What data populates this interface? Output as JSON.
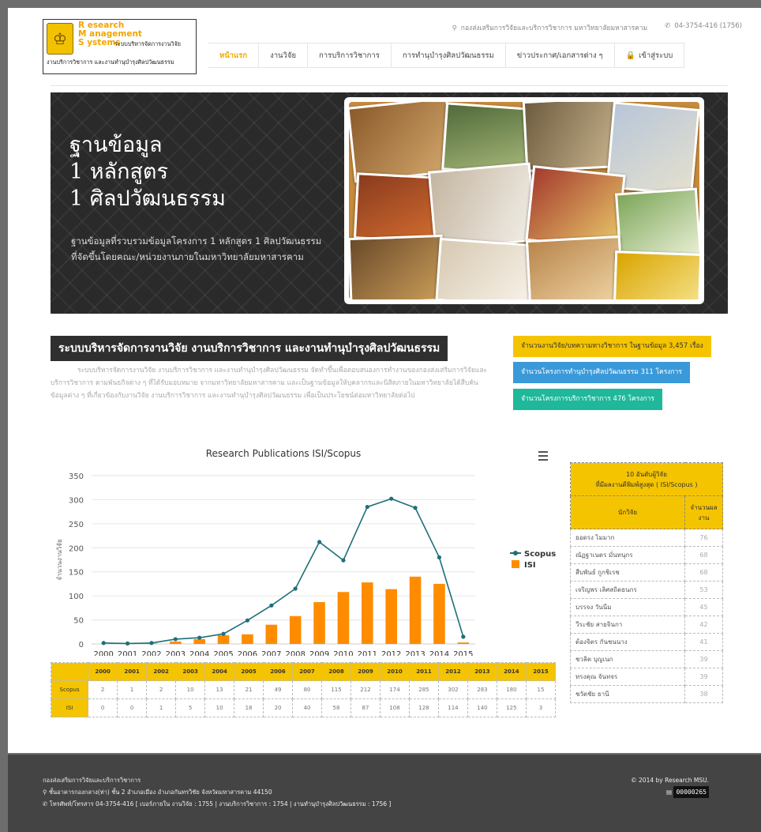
{
  "header": {
    "logo": {
      "letters": [
        "R esearch",
        "M anagement",
        "S ystems"
      ],
      "tagline": "ระบบบริหารจัดการงานวิจัย",
      "subtitle": "งานบริการวิชาการ และงานทำนุบำรุงศิลปวัฒนธรรม"
    },
    "address": "กองส่งเสริมการวิจัยและบริการวิชาการ มหาวิทยาลัยมหาสารคาม",
    "phone": "04-3754-416 (1756)",
    "nav": [
      "หน้าแรก",
      "งานวิจัย",
      "การบริการวิชาการ",
      "การทำนุบำรุงศิลปวัฒนธรรม",
      "ข่าวประกาศ/เอกสารต่าง ๆ",
      "เข้าสู่ระบบ"
    ]
  },
  "banner": {
    "headline": [
      "ฐานข้อมูล",
      "1 หลักสูตร",
      "1 ศิลปวัฒนธรรม"
    ],
    "text": "ฐานข้อมูลที่รวบรวมข้อมูลโครงการ 1 หลักสูตร 1 ศิลปวัฒนธรรม ที่จัดขึ้นโดยคณะ/หน่วยงานภายในมหาวิทยาลัยมหาสารคาม"
  },
  "section": {
    "title": "ระบบบริหารจัดการงานวิจัย งานบริการวิชาการ และงานทำนุบำรุงศิลปวัฒนธรรม",
    "description": "ระบบบริหารจัดการงานวิจัย งานบริการวิชาการ และงานทำนุบำรุงศิลปวัฒนธรรม จัดทำขึ้นเพื่อตอบสนองการทำงานของกองส่งเสริมการวิจัยและบริการวิชาการ ตามพันธกิจต่าง ๆ ที่ได้รับมอบหมาย จากมหาวิทยาลัยมหาสารคาม และเป็นฐานข้อมูลให้บุคลากรและนิสิตภายในมหาวิทยาลัยได้สืบค้นข้อมูลต่าง ๆ ที่เกี่ยวข้องกับงานวิจัย งานบริการวิชาการ และงานทำนุบำรุงศิลปวัฒนธรรม เพื่อเป็นประโยชน์ต่อมหาวิทยาลัยต่อไป"
  },
  "stats": [
    {
      "label": "จำนวนงานวิจัย/บทความทางวิชาการ ในฐานข้อมูล 3,457 เรื่อง",
      "color": "#f5c400"
    },
    {
      "label": "จำนวนโครงการทำนุบำรุงศิลปวัฒนธรรม 311 โครงการ",
      "color": "#3a9ad9"
    },
    {
      "label": "จำนวนโครงการบริการวิชาการ 476 โครงการ",
      "color": "#1fb89a"
    }
  ],
  "chart_data": {
    "type": "bar",
    "title": "Research Publications ISI/Scopus",
    "ylabel": "จำนวนงานวิจัย",
    "xlabel": "",
    "ylim": [
      0,
      350
    ],
    "yticks": [
      0,
      50,
      100,
      150,
      200,
      250,
      300,
      350
    ],
    "categories": [
      "2000",
      "2001",
      "2002",
      "2003",
      "2004",
      "2005",
      "2006",
      "2007",
      "2008",
      "2009",
      "2010",
      "2011",
      "2012",
      "2013",
      "2014",
      "2015"
    ],
    "series": [
      {
        "name": "Scopus",
        "type": "line",
        "color": "#1f6f78",
        "values": [
          2,
          1,
          2,
          10,
          13,
          21,
          49,
          80,
          115,
          212,
          174,
          285,
          302,
          283,
          180,
          15
        ]
      },
      {
        "name": "ISI",
        "type": "bar",
        "color": "#ff8c00",
        "values": [
          0,
          0,
          1,
          5,
          10,
          18,
          20,
          40,
          58,
          87,
          108,
          128,
          114,
          140,
          125,
          3
        ]
      }
    ],
    "legend": "right",
    "menu_icon": "hamburger-icon",
    "grid": true
  },
  "table_rows": [
    {
      "label": "Scopus",
      "values": [
        "2",
        "1",
        "2",
        "10",
        "13",
        "21",
        "49",
        "80",
        "115",
        "212",
        "174",
        "285",
        "302",
        "283",
        "180",
        "15"
      ]
    },
    {
      "label": "ISI",
      "values": [
        "0",
        "0",
        "1",
        "5",
        "10",
        "18",
        "20",
        "40",
        "58",
        "87",
        "108",
        "128",
        "114",
        "140",
        "125",
        "3"
      ]
    }
  ],
  "top10": {
    "caption": [
      "10 อันดับผู้วิจัย",
      "ที่มีผลงานตีพิมพ์สูงสุด ( ISI/Scopus )"
    ],
    "col_name": "นักวิจัย",
    "col_count": "จำนวนผลงาน",
    "rows": [
      {
        "name": "ยอดรง ไมมาก",
        "count": "76"
      },
      {
        "name": "ณัฏฐาเนตร มั่นทนุกร",
        "count": "68"
      },
      {
        "name": "สืบพันธ์ กูกชิเรช",
        "count": "68"
      },
      {
        "name": "เจริญพร เลิศสถิตธนกร",
        "count": "53"
      },
      {
        "name": "บรรจง วันนีม",
        "count": "45"
      },
      {
        "name": "วีระชัย สายจินกา",
        "count": "42"
      },
      {
        "name": "ต้องจิตร กันชนนาง",
        "count": "41"
      },
      {
        "name": "ชวลิต บุญเนก",
        "count": "39"
      },
      {
        "name": "ทรงคุณ จันทจร",
        "count": "39"
      },
      {
        "name": "ชวัตชัย ธานี",
        "count": "38"
      }
    ]
  },
  "footer": {
    "org": "กองส่งเสริมการวิจัยและบริการวิชาการ",
    "address": "ชั้นอาคารกองกลาง(ท่า) ชั้น 2 อำเภอเมือง อำเภอกันทรวิชัย จังหวัดมหาสารคาม 44150",
    "phone": "โทรศัพท์/โทรสาร 04-3754-416 [ เบอร์ภายใน งานวิจัย : 1755 | งานบริการวิชาการ : 1754 | งานทำนุบำรุงศิลปวัฒนธรรม : 1756 ]",
    "copyright": "© 2014 by Research MSU.",
    "counter": "00000265"
  }
}
